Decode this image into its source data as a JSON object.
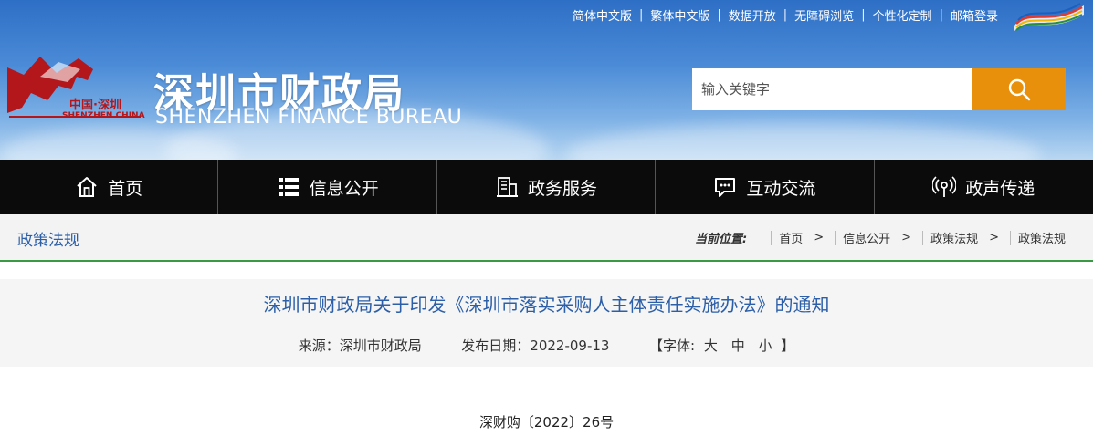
{
  "header": {
    "top_links": [
      "简体中文版",
      "繁体中文版",
      "数据开放",
      "无障碍浏览",
      "个性化定制",
      "邮箱登录"
    ],
    "logo_text_cn": "中国·深圳",
    "logo_text_en": "SHENZHEN CHINA",
    "title_cn": "深圳市财政局",
    "title_en": "SHENZHEN FINANCE BUREAU",
    "search_placeholder": "输入关键字"
  },
  "nav": {
    "items": [
      {
        "label": "首页",
        "icon": "home-icon"
      },
      {
        "label": "信息公开",
        "icon": "list-icon"
      },
      {
        "label": "政务服务",
        "icon": "building-icon"
      },
      {
        "label": "互动交流",
        "icon": "chat-icon"
      },
      {
        "label": "政声传递",
        "icon": "broadcast-icon"
      }
    ]
  },
  "breadcrumb": {
    "section_title": "政策法规",
    "label": "当前位置:",
    "items": [
      "首页",
      "信息公开",
      "政策法规",
      "政策法规"
    ]
  },
  "article": {
    "title": "深圳市财政局关于印发《深圳市落实采购人主体责任实施办法》的通知",
    "source_label": "来源：",
    "source": "深圳市财政局",
    "date_label": "发布日期：",
    "date": "2022-09-13",
    "font_open": "【字体:",
    "font_sizes": [
      "大",
      "中",
      "小"
    ],
    "font_close": "】",
    "doc_number": "深财购〔2022〕26号"
  },
  "colors": {
    "accent_blue": "#2c5fa8",
    "search_orange": "#e8900c",
    "nav_bg": "#0b0b0b",
    "divider_green": "#3a9a44"
  }
}
